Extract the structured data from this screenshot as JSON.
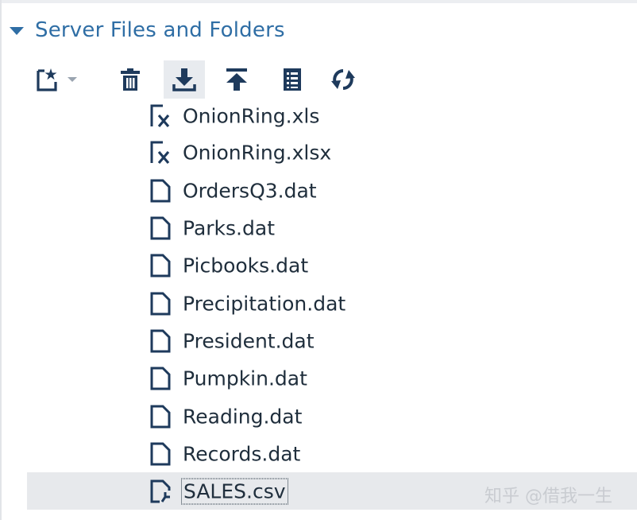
{
  "section": {
    "title": "Server Files and Folders",
    "expanded": true
  },
  "toolbar": {
    "buttons": [
      {
        "name": "new-menu-button",
        "icon": "new-file-icon",
        "has_dropdown": true
      },
      {
        "name": "delete-button",
        "icon": "trash-icon"
      },
      {
        "name": "download-button",
        "icon": "download-icon",
        "active": true
      },
      {
        "name": "upload-button",
        "icon": "upload-icon"
      },
      {
        "name": "properties-button",
        "icon": "list-icon"
      },
      {
        "name": "refresh-button",
        "icon": "refresh-icon"
      }
    ]
  },
  "files": [
    {
      "name": "OnionRing.xls",
      "icon": "excel-file-icon"
    },
    {
      "name": "OnionRing.xlsx",
      "icon": "excel-file-icon"
    },
    {
      "name": "OrdersQ3.dat",
      "icon": "file-icon"
    },
    {
      "name": "Parks.dat",
      "icon": "file-icon"
    },
    {
      "name": "Picbooks.dat",
      "icon": "file-icon"
    },
    {
      "name": "Precipitation.dat",
      "icon": "file-icon"
    },
    {
      "name": "President.dat",
      "icon": "file-icon"
    },
    {
      "name": "Pumpkin.dat",
      "icon": "file-icon"
    },
    {
      "name": "Reading.dat",
      "icon": "file-icon"
    },
    {
      "name": "Records.dat",
      "icon": "file-icon"
    },
    {
      "name": "SALES.csv",
      "icon": "csv-file-icon",
      "selected": true
    }
  ],
  "watermark": "知乎 @借我一生",
  "colors": {
    "accent": "#2f6ea5",
    "icon": "#1e3a5c",
    "text": "#1f2e3c",
    "selected_bg": "#e7e9ec",
    "active_button_bg": "#e8ebef"
  }
}
